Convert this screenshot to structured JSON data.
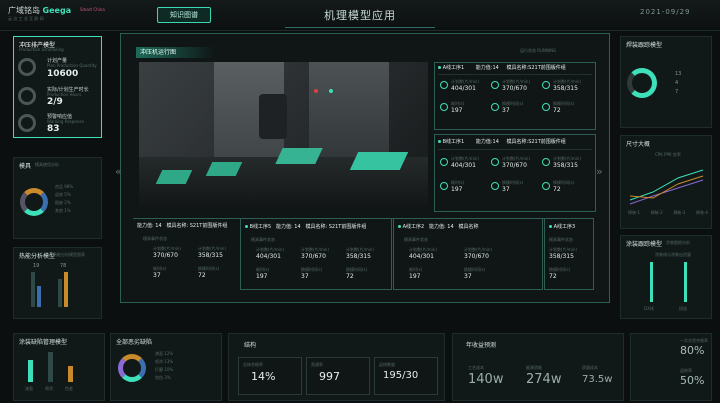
{
  "header": {
    "logo": "广域铭岛",
    "logo_brand": "Geega",
    "logo_sub": "云 边 工 业 互 联 网",
    "event_logo": "Smart China",
    "knowledge_button": "知识图谱",
    "title": "机理模型应用",
    "date": "2021-09/29"
  },
  "left_panel": {
    "title": "冲压排产模型",
    "subtitle": "Production Scheduling",
    "metrics": [
      {
        "label": "计划产量",
        "sub": "Plan Production Quantity",
        "value": "10600"
      },
      {
        "label": "实际/计划生产时长",
        "sub": "Production Hours",
        "value": "2/9"
      },
      {
        "label": "预警响应值",
        "sub": "Warning Response",
        "value": "83"
      }
    ]
  },
  "left_mid": {
    "title": "模具",
    "subtitle": "模具使用分析",
    "legend": [
      "良品 98%",
      "返修 5%",
      "报废 2%",
      "其他 1%"
    ],
    "legend_extra": "3%"
  },
  "left_bottom": {
    "title": "热能分析模型",
    "subtitle": "热能分析模型图表",
    "values": [
      "19",
      "78"
    ]
  },
  "main_panel": {
    "title": "冲压机运行图",
    "top_right_label": "运行状态 RUNNING",
    "prev": "«",
    "next": "»"
  },
  "stations_right": [
    {
      "name": "A线工序1",
      "cap_label": "能力值",
      "cap": "14",
      "mold_label": "模具名称",
      "mold": "S21T前围版件组",
      "metrics": [
        {
          "label": "计划数(片/min)",
          "value": "404/301"
        },
        {
          "label": "计划数(片/min)",
          "value": "370/670"
        },
        {
          "label": "计划数(片/min)",
          "value": "358/315"
        },
        {
          "label": "耗时(s)",
          "value": "197"
        },
        {
          "label": "换模时间(s)",
          "value": "37"
        },
        {
          "label": "换模时间(s)",
          "value": "72"
        }
      ]
    },
    {
      "name": "B线工序1",
      "cap_label": "能力值",
      "cap": "14",
      "mold_label": "模具名称",
      "mold": "S21T前围版件组",
      "metrics": [
        {
          "label": "计划数(片/min)",
          "value": "404/301"
        },
        {
          "label": "计划数(片/min)",
          "value": "370/670"
        },
        {
          "label": "计划数(片/min)",
          "value": "358/315"
        },
        {
          "label": "耗时(s)",
          "value": "197"
        },
        {
          "label": "换模时间(s)",
          "value": "37"
        },
        {
          "label": "换模时间(s)",
          "value": "72"
        }
      ]
    }
  ],
  "stations_bottom": [
    {
      "name": "A线工序2",
      "cap_label": "能力值",
      "cap": "14",
      "mold_label": "模具名称",
      "mold": "S21T前围版件组",
      "group": "模具事件状态",
      "metrics": [
        {
          "label": "计划数(片/min)",
          "value": "370/670"
        },
        {
          "label": "计划数(片/min)",
          "value": "358/315"
        },
        {
          "label": "耗时(s)",
          "value": "37"
        },
        {
          "label": "换模时间(s)",
          "value": "72"
        }
      ]
    },
    {
      "name": "B线工序5",
      "cap_label": "能力值",
      "cap": "14",
      "mold_label": "模具名称",
      "mold": "S21T前围版件组",
      "group": "模具事件状态",
      "metrics": [
        {
          "label": "计划数(片/min)",
          "value": "404/301"
        },
        {
          "label": "计划数(片/min)",
          "value": "370/670"
        },
        {
          "label": "计划数(片/min)",
          "value": "358/315"
        },
        {
          "label": "耗时(s)",
          "value": "197"
        },
        {
          "label": "换模时间(s)",
          "value": "37"
        },
        {
          "label": "换模时间(s)",
          "value": "72"
        }
      ]
    },
    {
      "name": "A线工序2",
      "cap_label": "能力值",
      "cap": "14",
      "mold_label": "模具名称",
      "mold": "S21T前围版件组",
      "group": "模具事件状态",
      "metrics": [
        {
          "label": "计划数(片/min)",
          "value": "404/301"
        },
        {
          "label": "计划数(片/min)",
          "value": "370/670"
        },
        {
          "label": "耗时(s)",
          "value": "197"
        },
        {
          "label": "换模时间(s)",
          "value": "37"
        }
      ]
    },
    {
      "name": "A线工序3",
      "cap_label": "",
      "cap": "",
      "mold_label": "",
      "mold": "",
      "group": "模具事件状态",
      "metrics": [
        {
          "label": "计划数(片/min)",
          "value": "358/315"
        },
        {
          "label": "换模时间(s)",
          "value": "72"
        }
      ]
    }
  ],
  "right_top": {
    "title": "焊装跟踪模型",
    "subtitle": "",
    "values": [
      "13",
      "4",
      "7",
      "0"
    ]
  },
  "right_mid": {
    "title": "尺寸大概",
    "legend": [
      "CPK",
      "PPK",
      "良率"
    ],
    "x_labels": [
      "焊装-1",
      "焊装-2",
      "焊装-3",
      "焊装-4"
    ]
  },
  "right_bottom": {
    "title": "涂装跟踪模型",
    "subtitle": "涂装跟踪分析",
    "label": "涂装线与涂装出货量",
    "x_labels": [
      "DX线",
      "班组"
    ]
  },
  "bottom": {
    "panel1": {
      "title": "涂装缺陷管理模型",
      "subtitle": "",
      "x_labels": [
        "漆面",
        "喷涂",
        "色差"
      ]
    },
    "panel2": {
      "title": "全部恶劣缺陷",
      "legend": [
        "漆面 12%",
        "喷涂 13%",
        "打磨 10%",
        "划伤 3%",
        "其他 5%"
      ]
    },
    "panel3": {
      "title": "结构",
      "cards": [
        {
          "label": "总体合格率",
          "value": "14%"
        },
        {
          "label": "直通率",
          "value": "997"
        },
        {
          "label": "返修数量",
          "value": "195/30"
        }
      ]
    },
    "panel4": {
      "title": "年收益预测",
      "cards": [
        {
          "label": "工艺成本",
          "value": "140w"
        },
        {
          "label": "能源消耗",
          "value": "274w"
        },
        {
          "label": "质量成本",
          "value": "73.5w"
        }
      ]
    },
    "panel5": {
      "cards": [
        {
          "label": "一次交验合格率",
          "value": "80%"
        },
        {
          "label": "返修率",
          "value": "50%"
        }
      ]
    }
  }
}
